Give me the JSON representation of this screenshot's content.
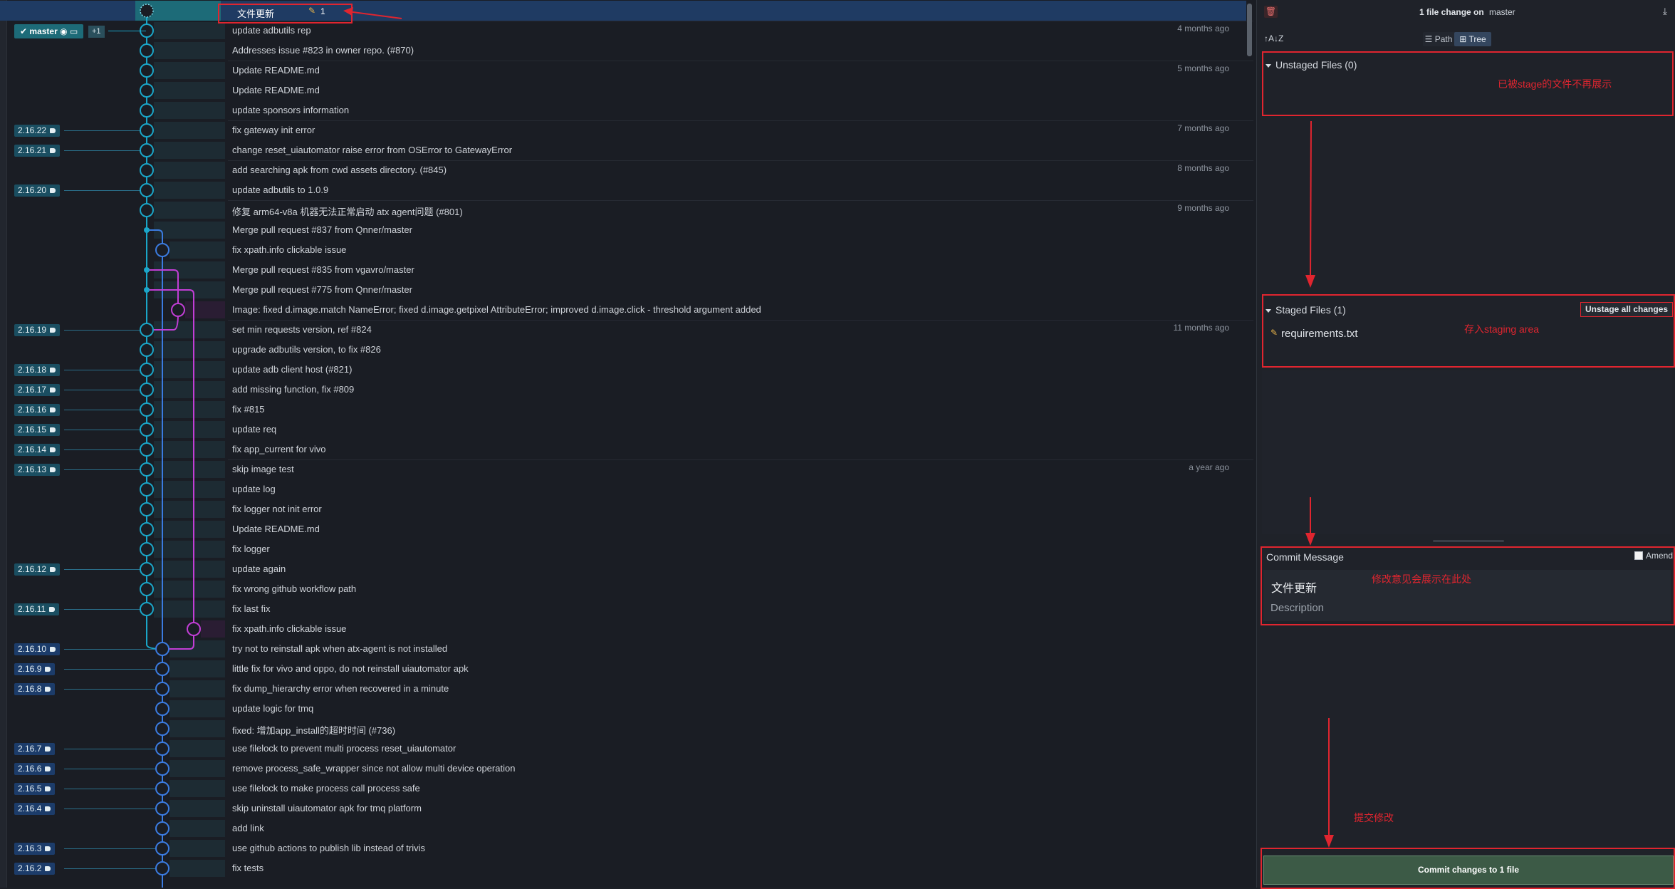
{
  "colors": {
    "accent": "#1d6b78",
    "wip_row": "#1f3b63",
    "annotation": "#e0252f",
    "lane_cyan": "#1aa6c8",
    "lane_blue": "#3b7be0",
    "lane_magenta": "#c23ed6",
    "commit_btn": "#3c5a46"
  },
  "wip": {
    "title": "文件更新",
    "edit_icon": "pencil-icon",
    "count": "1"
  },
  "branch": {
    "name": "master",
    "icons": [
      "check-icon",
      "github-icon",
      "laptop-icon"
    ],
    "extra": "+1"
  },
  "commits": [
    {
      "msg": "update adbutils rep",
      "age": "4 months ago",
      "tag": "",
      "lane": 0
    },
    {
      "msg": "Addresses issue #823 in owner repo. (#870)",
      "age": "",
      "tag": "",
      "lane": 0
    },
    {
      "msg": "Update README.md",
      "age": "5 months ago",
      "tag": "",
      "lane": 0
    },
    {
      "msg": "Update README.md",
      "age": "",
      "tag": "",
      "lane": 0
    },
    {
      "msg": "update sponsors information",
      "age": "",
      "tag": "",
      "lane": 0
    },
    {
      "msg": "fix gateway init error",
      "age": "7 months ago",
      "tag": "2.16.22",
      "lane": 0
    },
    {
      "msg": "change reset_uiautomator raise error from OSError to GatewayError",
      "age": "",
      "tag": "2.16.21",
      "lane": 0
    },
    {
      "msg": "add searching apk from cwd assets directory. (#845)",
      "age": "8 months ago",
      "tag": "",
      "lane": 0
    },
    {
      "msg": "update adbutils to 1.0.9",
      "age": "",
      "tag": "2.16.20",
      "lane": 0
    },
    {
      "msg": "修复 arm64-v8a 机器无法正常启动 atx agent问题 (#801)",
      "age": "9 months ago",
      "tag": "",
      "lane": 0
    },
    {
      "msg": "Merge pull request #837 from Qnner/master",
      "age": "",
      "tag": "",
      "lane": 0,
      "merge": true
    },
    {
      "msg": "fix xpath.info clickable issue",
      "age": "",
      "tag": "",
      "lane": 1
    },
    {
      "msg": "Merge pull request #835 from vgavro/master",
      "age": "",
      "tag": "",
      "lane": 0,
      "merge": true
    },
    {
      "msg": "Merge pull request #775 from Qnner/master",
      "age": "",
      "tag": "",
      "lane": 0,
      "merge": true
    },
    {
      "msg": "Image: fixed d.image.match NameError; fixed d.image.getpixel AttributeError; improved d.image.click - threshold argument added",
      "age": "",
      "tag": "",
      "lane": 2
    },
    {
      "msg": "set min requests version, ref #824",
      "age": "11 months ago",
      "tag": "2.16.19",
      "lane": 0
    },
    {
      "msg": "upgrade adbutils version, to fix #826",
      "age": "",
      "tag": "",
      "lane": 0
    },
    {
      "msg": "update adb client host (#821)",
      "age": "",
      "tag": "2.16.18",
      "lane": 0
    },
    {
      "msg": "add missing function, fix #809",
      "age": "",
      "tag": "2.16.17",
      "lane": 0
    },
    {
      "msg": "fix #815",
      "age": "",
      "tag": "2.16.16",
      "lane": 0
    },
    {
      "msg": "update req",
      "age": "",
      "tag": "2.16.15",
      "lane": 0
    },
    {
      "msg": "fix app_current for vivo",
      "age": "",
      "tag": "2.16.14",
      "lane": 0
    },
    {
      "msg": "skip image test",
      "age": "a year ago",
      "tag": "2.16.13",
      "lane": 0
    },
    {
      "msg": "update log",
      "age": "",
      "tag": "",
      "lane": 0
    },
    {
      "msg": "fix logger not init error",
      "age": "",
      "tag": "",
      "lane": 0
    },
    {
      "msg": "Update README.md",
      "age": "",
      "tag": "",
      "lane": 0
    },
    {
      "msg": "fix logger",
      "age": "",
      "tag": "",
      "lane": 0
    },
    {
      "msg": "update again",
      "age": "",
      "tag": "2.16.12",
      "lane": 0
    },
    {
      "msg": "fix wrong github workflow path",
      "age": "",
      "tag": "",
      "lane": 0
    },
    {
      "msg": "fix last fix",
      "age": "",
      "tag": "2.16.11",
      "lane": 0
    },
    {
      "msg": "fix xpath.info clickable issue",
      "age": "",
      "tag": "",
      "lane": 3
    },
    {
      "msg": "try not to reinstall apk when atx-agent is not installed",
      "age": "",
      "tag": "2.16.10",
      "lane": 1
    },
    {
      "msg": "little fix for vivo and oppo, do not reinstall uiautomator apk",
      "age": "",
      "tag": "2.16.9",
      "lane": 1
    },
    {
      "msg": "fix dump_hierarchy error when recovered in a minute",
      "age": "",
      "tag": "2.16.8",
      "lane": 1
    },
    {
      "msg": "update logic for tmq",
      "age": "",
      "tag": "",
      "lane": 1
    },
    {
      "msg": "fixed: 增加app_install的超时时间 (#736)",
      "age": "",
      "tag": "",
      "lane": 1
    },
    {
      "msg": "use filelock to prevent multi process reset_uiautomator",
      "age": "",
      "tag": "2.16.7",
      "lane": 1
    },
    {
      "msg": "remove process_safe_wrapper since not allow multi device operation",
      "age": "",
      "tag": "2.16.6",
      "lane": 1
    },
    {
      "msg": "use filelock to make process call process safe",
      "age": "",
      "tag": "2.16.5",
      "lane": 1
    },
    {
      "msg": "skip uninstall uiautomator apk for tmq platform",
      "age": "",
      "tag": "2.16.4",
      "lane": 1
    },
    {
      "msg": "add link",
      "age": "",
      "tag": "",
      "lane": 1
    },
    {
      "msg": "use github actions to publish lib instead of trivis",
      "age": "",
      "tag": "2.16.3",
      "lane": 1
    },
    {
      "msg": "fix tests",
      "age": "",
      "tag": "2.16.2",
      "lane": 1
    }
  ],
  "right": {
    "trash_icon": "trash-icon",
    "header_prefix": "1 file change on",
    "header_branch": "master",
    "download_icon": "download-icon",
    "sort_icon": "sort-az-icon",
    "view_path": "Path",
    "view_tree": "Tree",
    "unstaged_title": "Unstaged Files (0)",
    "unstaged_note": "已被stage的文件不再展示",
    "staged_title": "Staged Files (1)",
    "unstage_all": "Unstage all changes",
    "staged_file": "requirements.txt",
    "staged_note": "存入staging area",
    "commit_msg_title": "Commit Message",
    "amend_label": "Amend",
    "summary": "文件更新",
    "summary_note": "修改意见会展示在此处",
    "description_placeholder": "Description",
    "commit_note": "提交修改",
    "commit_button": "Commit changes to 1 file"
  }
}
